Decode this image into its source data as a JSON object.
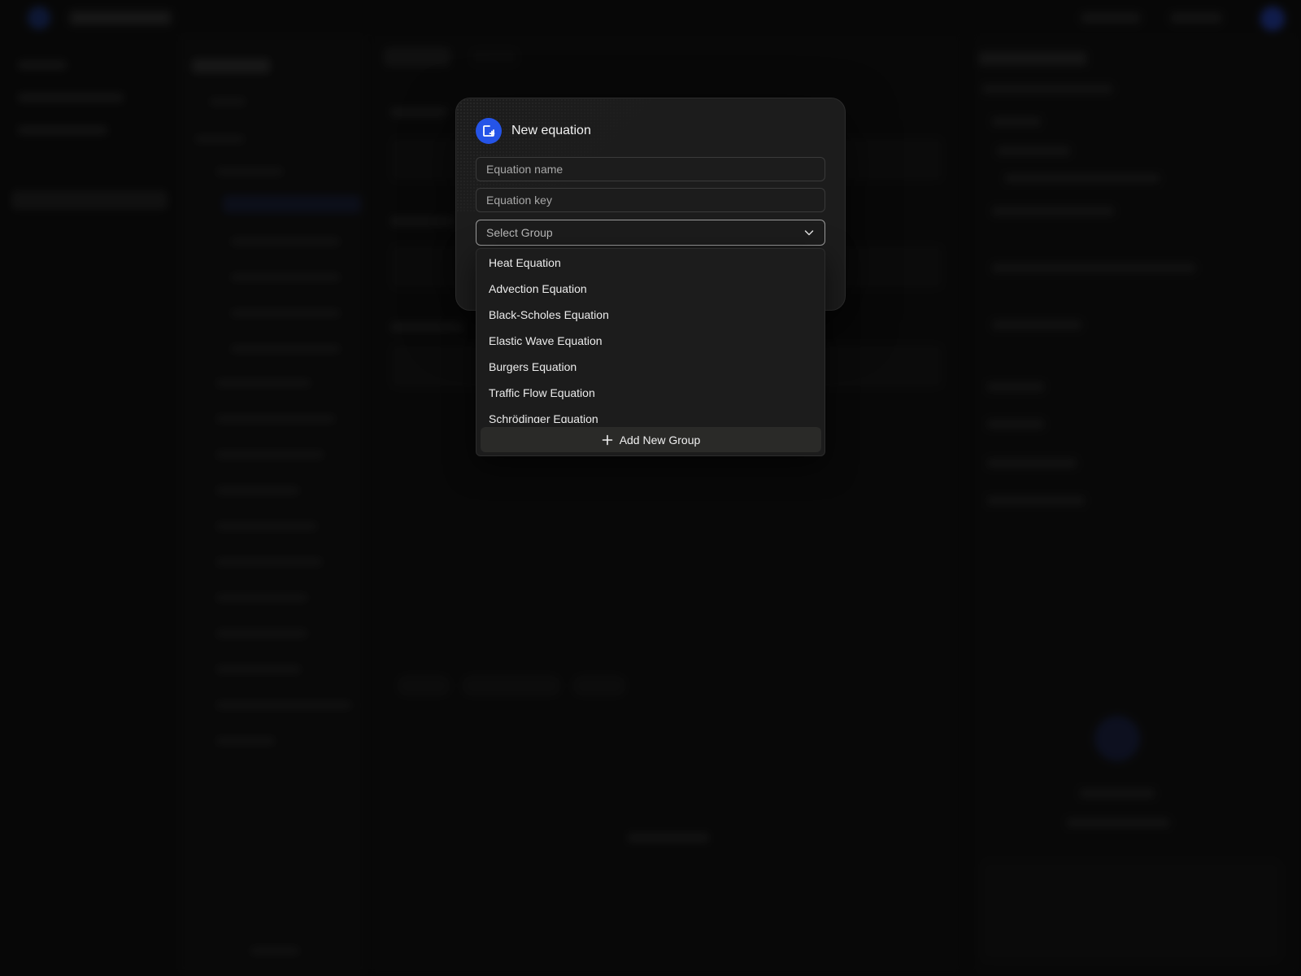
{
  "modal": {
    "title": "New equation",
    "icon": "new-equation-icon",
    "accent": "#2554e8",
    "name_placeholder": "Equation name",
    "key_placeholder": "Equation key",
    "group_select": {
      "placeholder": "Select Group",
      "options": [
        "Heat Equation",
        "Advection Equation",
        "Black-Scholes Equation",
        "Elastic Wave Equation",
        "Burgers Equation",
        "Traffic Flow Equation",
        "Schrödinger Equation"
      ],
      "add_label": "Add New Group"
    }
  }
}
